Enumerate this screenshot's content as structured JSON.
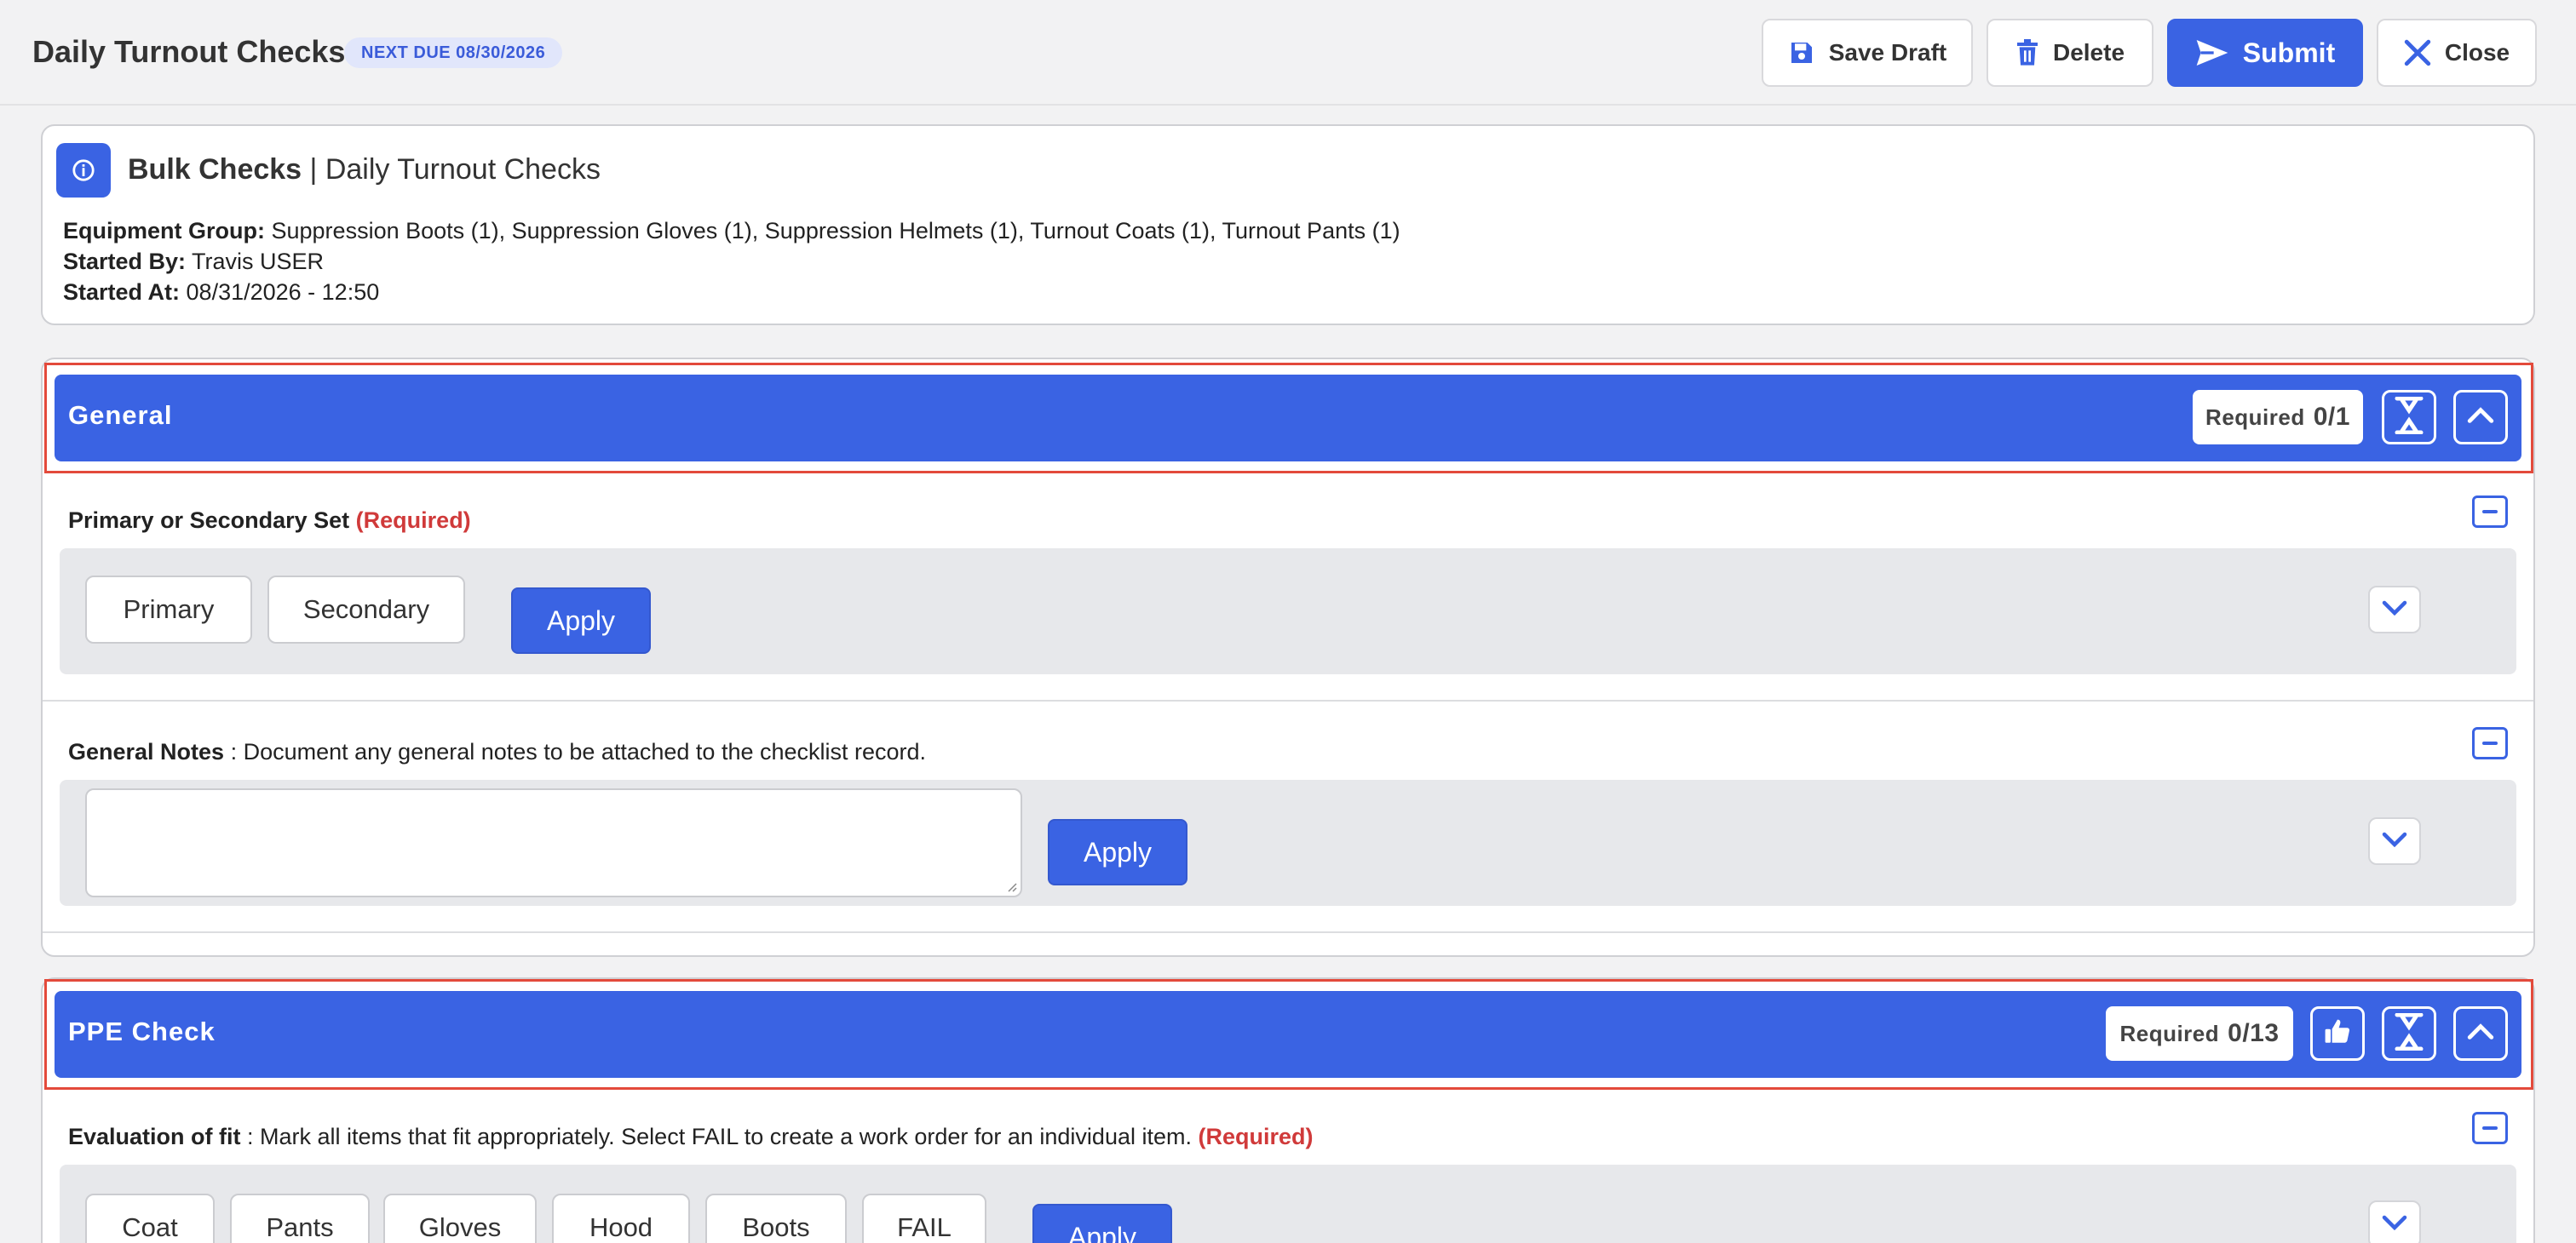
{
  "header": {
    "title": "Daily Turnout Checks",
    "due_badge": "NEXT DUE 08/30/2026",
    "save_draft": "Save Draft",
    "delete": "Delete",
    "submit": "Submit",
    "close": "Close"
  },
  "info": {
    "heading_bold": "Bulk Checks",
    "heading_rest": "| Daily Turnout Checks",
    "equipment_label": "Equipment Group:",
    "equipment_value": "Suppression Boots (1), Suppression Gloves (1), Suppression Helmets (1), Turnout Coats (1), Turnout Pants (1)",
    "started_by_label": "Started By:",
    "started_by_value": "Travis USER",
    "started_at_label": "Started At:",
    "started_at_value": "08/31/2026 - 12:50"
  },
  "sections": {
    "general": {
      "title": "General",
      "required_label": "Required",
      "required_count": "0/1",
      "q1": {
        "label": "Primary or Secondary Set",
        "required": "(Required)",
        "options": [
          "Primary",
          "Secondary"
        ],
        "apply": "Apply"
      },
      "q2": {
        "label": "General Notes",
        "description": " : Document any general notes to be attached to the checklist record.",
        "notes_value": "",
        "apply": "Apply"
      }
    },
    "ppe": {
      "title": "PPE Check",
      "required_label": "Required",
      "required_count": "0/13",
      "q1": {
        "label": "Evaluation of fit",
        "description": " : Mark all items that fit appropriately. Select FAIL to create a work order for an individual item.",
        "required": "(Required)",
        "options": [
          "Coat",
          "Pants",
          "Gloves",
          "Hood",
          "Boots",
          "FAIL"
        ],
        "apply": "Apply"
      }
    }
  },
  "icons": {
    "save": "floppy-disk-icon",
    "delete": "trash-icon",
    "submit": "paper-plane-icon",
    "close": "x-icon",
    "info": "info-circle-icon",
    "collapse_all": "collapse-arrows-icon",
    "chevron_up": "chevron-up-icon",
    "chevron_down": "chevron-down-icon",
    "thumbs_up": "thumbs-up-icon"
  },
  "colors": {
    "primary": "#3a63e3",
    "required": "#d03a3a",
    "highlight_frame": "#e34a3b",
    "badge_bg": "#e1e6fb"
  }
}
